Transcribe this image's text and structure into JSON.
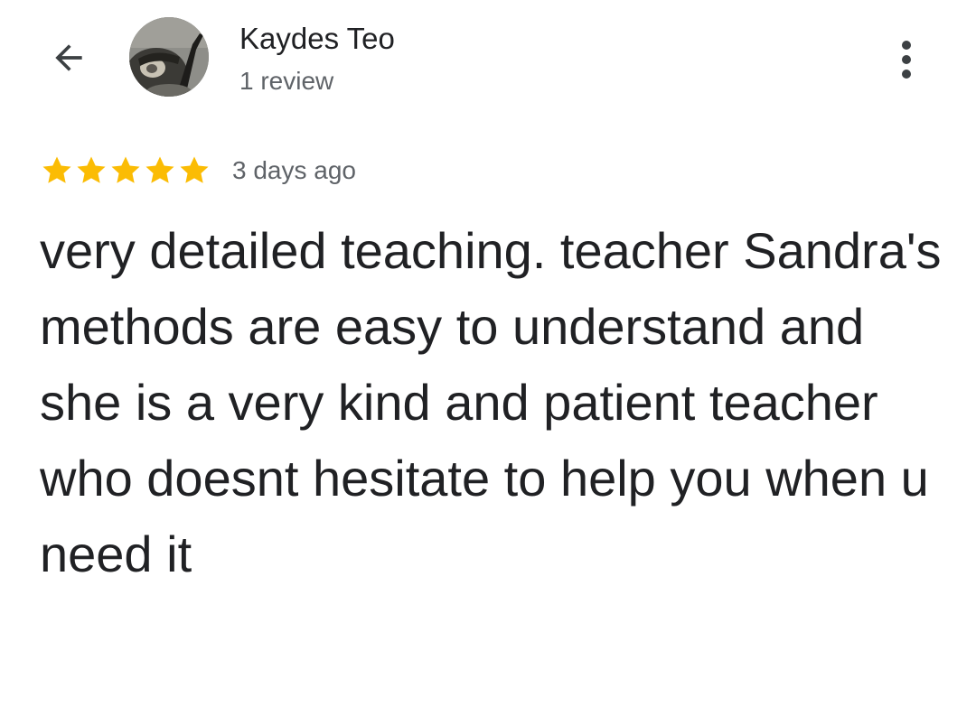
{
  "header": {
    "back_icon": "arrow-back-icon",
    "more_icon": "more-vert-icon",
    "author_name": "Kaydes Teo",
    "review_count": "1 review"
  },
  "review": {
    "rating": 5,
    "rating_max": 5,
    "star_color": "#FBBC04",
    "time_ago": "3 days ago",
    "text": "very detailed teaching. teacher Sandra's methods are easy to understand and she is a very kind and patient teacher who doesnt hesitate to help you when u need it"
  }
}
